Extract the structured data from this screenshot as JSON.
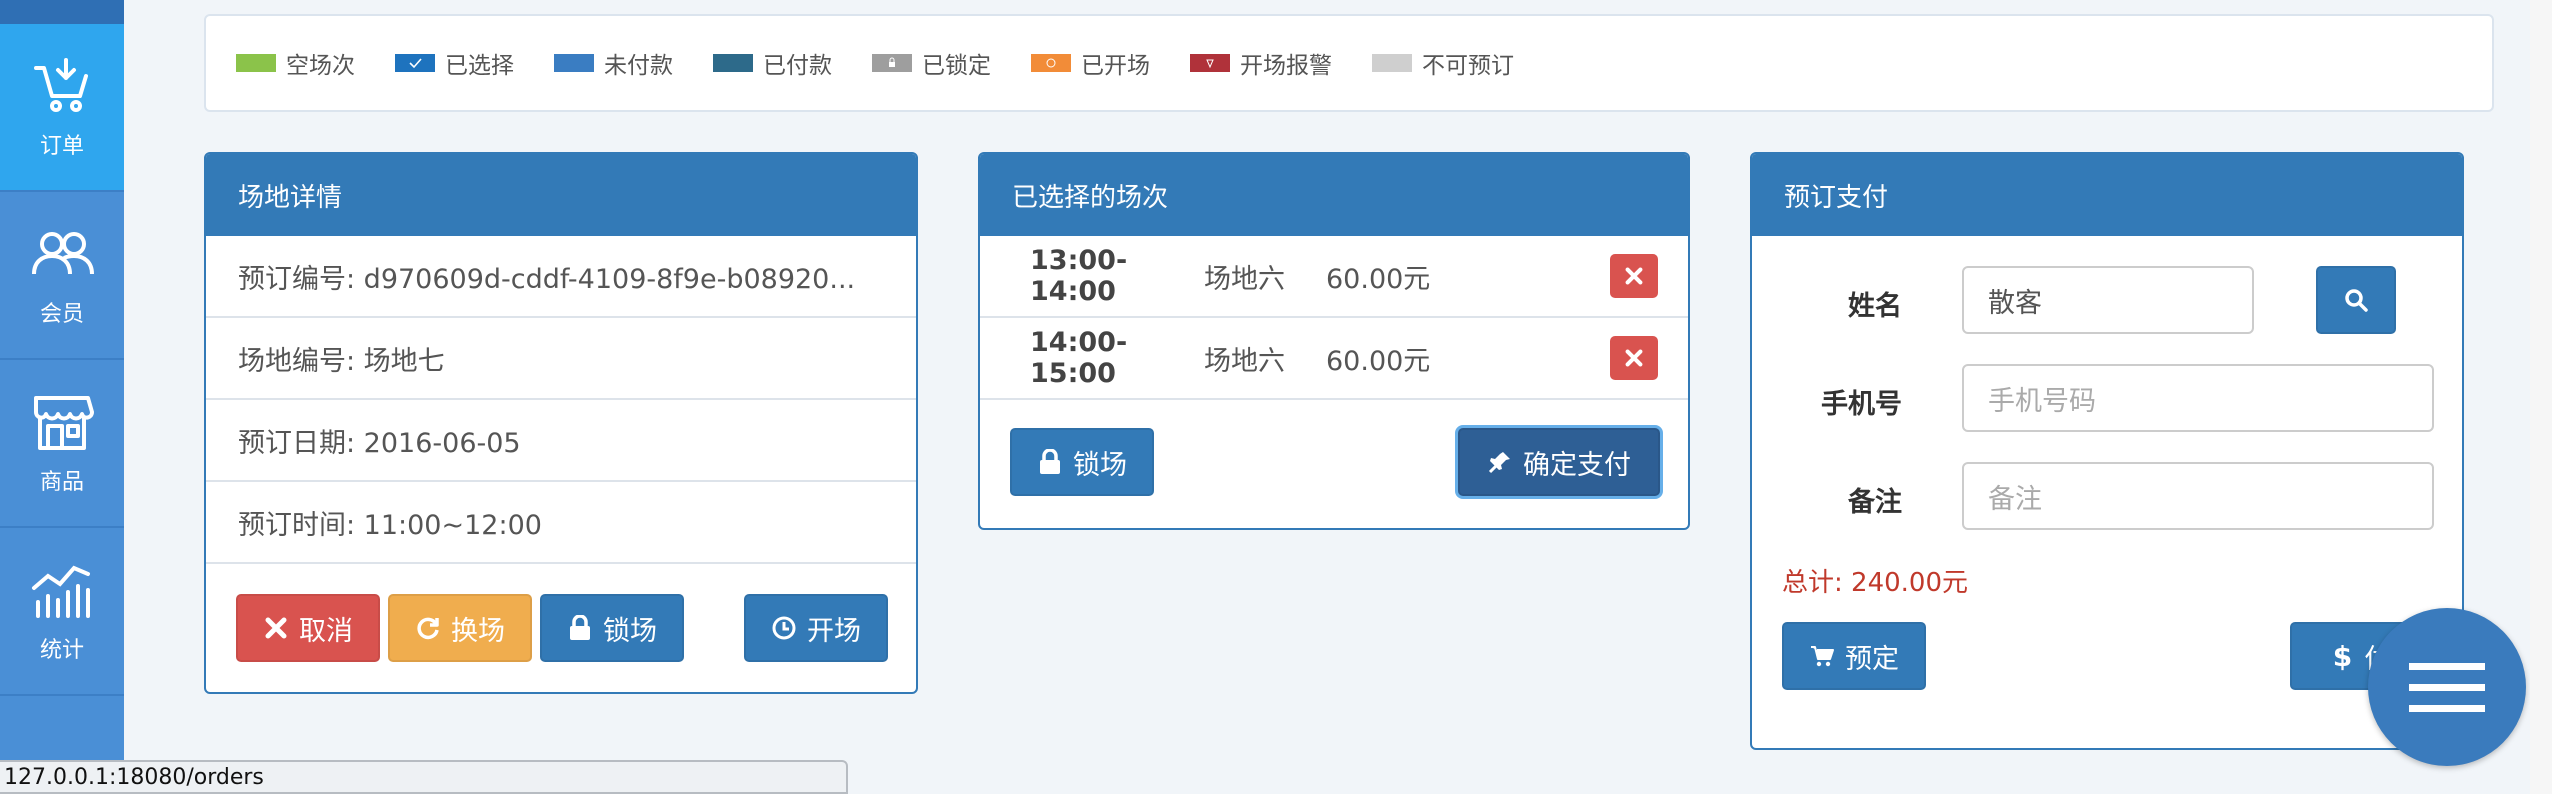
{
  "sidebar": {
    "items": [
      {
        "label": "订单",
        "icon": "cart-icon"
      },
      {
        "label": "会员",
        "icon": "members-icon"
      },
      {
        "label": "商品",
        "icon": "store-icon"
      },
      {
        "label": "统计",
        "icon": "stats-icon"
      }
    ]
  },
  "legend": [
    {
      "label": "空场次",
      "color": "#8bc34a"
    },
    {
      "label": "已选择",
      "color": "#1e73be"
    },
    {
      "label": "未付款",
      "color": "#3a7dc2"
    },
    {
      "label": "已付款",
      "color": "#2d6a8a"
    },
    {
      "label": "已锁定",
      "color": "#9e9e9e"
    },
    {
      "label": "已开场",
      "color": "#f28c38"
    },
    {
      "label": "开场报警",
      "color": "#b0323a"
    },
    {
      "label": "不可预订",
      "color": "#cfcfcf"
    }
  ],
  "detail": {
    "title": "场地详情",
    "order_no": "预订编号: d970609d-cddf-4109-8f9e-b08920...",
    "court_no": "场地编号: 场地七",
    "date": "预订日期: 2016-06-05",
    "time": "预订时间: 11:00~12:00",
    "cancel": "取消",
    "change": "换场",
    "lock": "锁场",
    "start": "开场"
  },
  "selected": {
    "title": "已选择的场次",
    "rows": [
      {
        "time": "13:00-14:00",
        "court": "场地六",
        "price": "60.00元"
      },
      {
        "time": "14:00-15:00",
        "court": "场地六",
        "price": "60.00元"
      }
    ],
    "lock": "锁场",
    "confirm": "确定支付"
  },
  "payment": {
    "title": "预订支付",
    "name_label": "姓名",
    "name_value": "散客",
    "phone_label": "手机号",
    "phone_placeholder": "手机号码",
    "note_label": "备注",
    "note_placeholder": "备注",
    "total": "总计: 240.00元",
    "reserve": "预定",
    "pay": "付"
  },
  "status_bar": "127.0.0.1:18080/orders"
}
